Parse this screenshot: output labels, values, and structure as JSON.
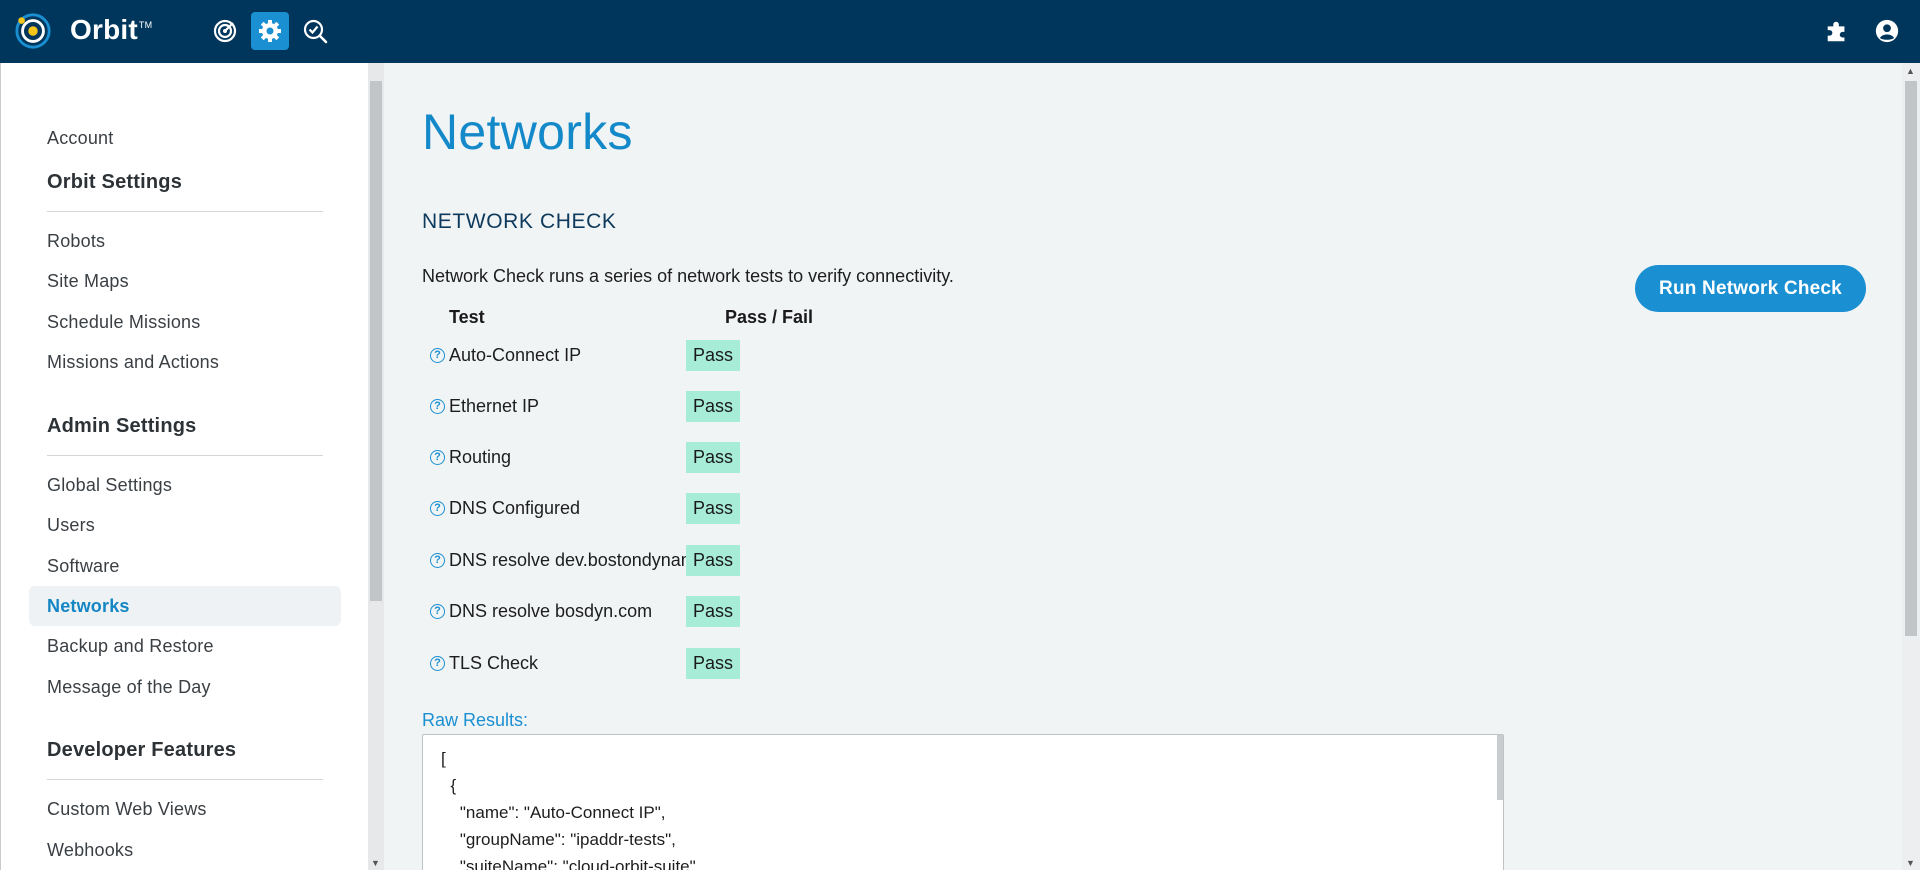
{
  "app": {
    "brand": "Orbit",
    "trademark": "TM"
  },
  "topbar": {
    "icons": [
      "target-icon",
      "gear-icon",
      "search-check-icon",
      "puzzle-icon",
      "user-icon"
    ],
    "active_color": "#1a8fd2",
    "bg_color": "#00365c"
  },
  "sidebar": {
    "account": "Account",
    "orbit_settings": {
      "header": "Orbit Settings",
      "items": [
        "Robots",
        "Site Maps",
        "Schedule Missions",
        "Missions and Actions"
      ]
    },
    "admin_settings": {
      "header": "Admin Settings",
      "items": [
        "Global Settings",
        "Users",
        "Software",
        "Networks",
        "Backup and Restore",
        "Message of the Day"
      ]
    },
    "developer_features": {
      "header": "Developer Features",
      "items": [
        "Custom Web Views",
        "Webhooks"
      ]
    },
    "active_item": "Networks"
  },
  "main": {
    "title": "Networks",
    "section_title": "NETWORK CHECK",
    "description": "Network Check runs a series of network tests to verify connectivity.",
    "run_button": "Run Network Check",
    "table": {
      "col_test": "Test",
      "col_result": "Pass / Fail",
      "rows": [
        {
          "test": "Auto-Connect IP",
          "result": "Pass"
        },
        {
          "test": "Ethernet IP",
          "result": "Pass"
        },
        {
          "test": "Routing",
          "result": "Pass"
        },
        {
          "test": "DNS Configured",
          "result": "Pass"
        },
        {
          "test": "DNS resolve dev.bostondynamics",
          "result": "Pass"
        },
        {
          "test": "DNS resolve bosdyn.com",
          "result": "Pass"
        },
        {
          "test": "TLS Check",
          "result": "Pass"
        }
      ]
    },
    "raw_label": "Raw Results:",
    "raw_text": "[\n  {\n    \"name\": \"Auto-Connect IP\",\n    \"groupName\": \"ipaddr-tests\",\n    \"suiteName\": \"cloud-orbit-suite\","
  },
  "colors": {
    "accent": "#1a8fd2",
    "pass_badge": "#a7ecd6",
    "title_blue": "#1489c9"
  }
}
